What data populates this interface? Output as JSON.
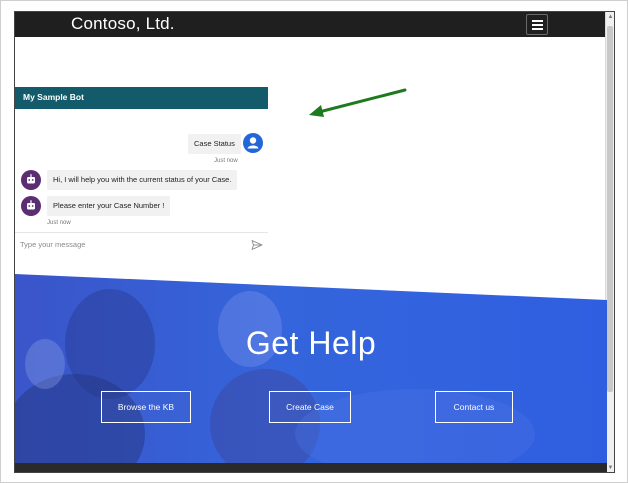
{
  "brand": {
    "name": "Contoso, Ltd."
  },
  "chat": {
    "title": "My Sample Bot",
    "messages": [
      {
        "sender": "user",
        "text": "Case Status",
        "time": "Just now"
      },
      {
        "sender": "bot",
        "text": "Hi, I will help you with the current status of your Case."
      },
      {
        "sender": "bot",
        "text": "Please enter your Case Number !",
        "time": "Just now"
      }
    ],
    "input_placeholder": "Type your message",
    "icons": {
      "user_avatar": "user-avatar-icon",
      "bot_avatar": "bot-avatar-icon",
      "send": "send-icon"
    }
  },
  "hero": {
    "title": "Get Help",
    "buttons": [
      {
        "label": "Browse the KB"
      },
      {
        "label": "Create Case"
      },
      {
        "label": "Contact us"
      }
    ]
  },
  "colors": {
    "nav_bg": "#1f1f1f",
    "chat_header": "#135b6b",
    "user_avatar": "#2266d8",
    "bot_avatar": "#5b2d73",
    "hero_blue": "#2f5fdc",
    "arrow": "#1f7a1f"
  }
}
